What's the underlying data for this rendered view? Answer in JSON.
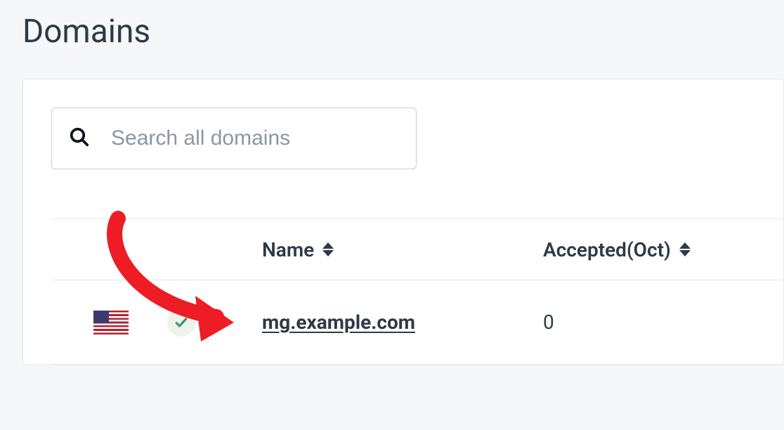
{
  "page": {
    "title": "Domains"
  },
  "search": {
    "placeholder": "Search all domains"
  },
  "table": {
    "columns": {
      "name": "Name",
      "accepted": "Accepted(Oct)"
    },
    "rows": [
      {
        "flag": "us",
        "status": "verified",
        "name": "mg.example.com",
        "accepted": "0"
      }
    ]
  },
  "icons": {
    "search": "search-icon",
    "sort": "sort-icon",
    "check": "check-icon",
    "flag_us": "flag-us-icon",
    "annotation_arrow": "annotation-arrow"
  }
}
